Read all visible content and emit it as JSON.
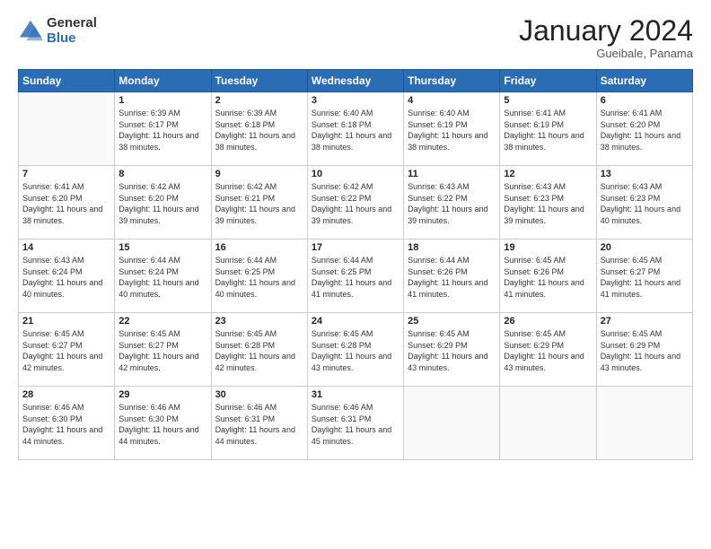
{
  "logo": {
    "general": "General",
    "blue": "Blue"
  },
  "header": {
    "month": "January 2024",
    "location": "Gueibale, Panama"
  },
  "weekdays": [
    "Sunday",
    "Monday",
    "Tuesday",
    "Wednesday",
    "Thursday",
    "Friday",
    "Saturday"
  ],
  "weeks": [
    [
      {
        "day": "",
        "sunrise": "",
        "sunset": "",
        "daylight": ""
      },
      {
        "day": "1",
        "sunrise": "Sunrise: 6:39 AM",
        "sunset": "Sunset: 6:17 PM",
        "daylight": "Daylight: 11 hours and 38 minutes."
      },
      {
        "day": "2",
        "sunrise": "Sunrise: 6:39 AM",
        "sunset": "Sunset: 6:18 PM",
        "daylight": "Daylight: 11 hours and 38 minutes."
      },
      {
        "day": "3",
        "sunrise": "Sunrise: 6:40 AM",
        "sunset": "Sunset: 6:18 PM",
        "daylight": "Daylight: 11 hours and 38 minutes."
      },
      {
        "day": "4",
        "sunrise": "Sunrise: 6:40 AM",
        "sunset": "Sunset: 6:19 PM",
        "daylight": "Daylight: 11 hours and 38 minutes."
      },
      {
        "day": "5",
        "sunrise": "Sunrise: 6:41 AM",
        "sunset": "Sunset: 6:19 PM",
        "daylight": "Daylight: 11 hours and 38 minutes."
      },
      {
        "day": "6",
        "sunrise": "Sunrise: 6:41 AM",
        "sunset": "Sunset: 6:20 PM",
        "daylight": "Daylight: 11 hours and 38 minutes."
      }
    ],
    [
      {
        "day": "7",
        "sunrise": "Sunrise: 6:41 AM",
        "sunset": "Sunset: 6:20 PM",
        "daylight": "Daylight: 11 hours and 38 minutes."
      },
      {
        "day": "8",
        "sunrise": "Sunrise: 6:42 AM",
        "sunset": "Sunset: 6:20 PM",
        "daylight": "Daylight: 11 hours and 39 minutes."
      },
      {
        "day": "9",
        "sunrise": "Sunrise: 6:42 AM",
        "sunset": "Sunset: 6:21 PM",
        "daylight": "Daylight: 11 hours and 39 minutes."
      },
      {
        "day": "10",
        "sunrise": "Sunrise: 6:42 AM",
        "sunset": "Sunset: 6:22 PM",
        "daylight": "Daylight: 11 hours and 39 minutes."
      },
      {
        "day": "11",
        "sunrise": "Sunrise: 6:43 AM",
        "sunset": "Sunset: 6:22 PM",
        "daylight": "Daylight: 11 hours and 39 minutes."
      },
      {
        "day": "12",
        "sunrise": "Sunrise: 6:43 AM",
        "sunset": "Sunset: 6:23 PM",
        "daylight": "Daylight: 11 hours and 39 minutes."
      },
      {
        "day": "13",
        "sunrise": "Sunrise: 6:43 AM",
        "sunset": "Sunset: 6:23 PM",
        "daylight": "Daylight: 11 hours and 40 minutes."
      }
    ],
    [
      {
        "day": "14",
        "sunrise": "Sunrise: 6:43 AM",
        "sunset": "Sunset: 6:24 PM",
        "daylight": "Daylight: 11 hours and 40 minutes."
      },
      {
        "day": "15",
        "sunrise": "Sunrise: 6:44 AM",
        "sunset": "Sunset: 6:24 PM",
        "daylight": "Daylight: 11 hours and 40 minutes."
      },
      {
        "day": "16",
        "sunrise": "Sunrise: 6:44 AM",
        "sunset": "Sunset: 6:25 PM",
        "daylight": "Daylight: 11 hours and 40 minutes."
      },
      {
        "day": "17",
        "sunrise": "Sunrise: 6:44 AM",
        "sunset": "Sunset: 6:25 PM",
        "daylight": "Daylight: 11 hours and 41 minutes."
      },
      {
        "day": "18",
        "sunrise": "Sunrise: 6:44 AM",
        "sunset": "Sunset: 6:26 PM",
        "daylight": "Daylight: 11 hours and 41 minutes."
      },
      {
        "day": "19",
        "sunrise": "Sunrise: 6:45 AM",
        "sunset": "Sunset: 6:26 PM",
        "daylight": "Daylight: 11 hours and 41 minutes."
      },
      {
        "day": "20",
        "sunrise": "Sunrise: 6:45 AM",
        "sunset": "Sunset: 6:27 PM",
        "daylight": "Daylight: 11 hours and 41 minutes."
      }
    ],
    [
      {
        "day": "21",
        "sunrise": "Sunrise: 6:45 AM",
        "sunset": "Sunset: 6:27 PM",
        "daylight": "Daylight: 11 hours and 42 minutes."
      },
      {
        "day": "22",
        "sunrise": "Sunrise: 6:45 AM",
        "sunset": "Sunset: 6:27 PM",
        "daylight": "Daylight: 11 hours and 42 minutes."
      },
      {
        "day": "23",
        "sunrise": "Sunrise: 6:45 AM",
        "sunset": "Sunset: 6:28 PM",
        "daylight": "Daylight: 11 hours and 42 minutes."
      },
      {
        "day": "24",
        "sunrise": "Sunrise: 6:45 AM",
        "sunset": "Sunset: 6:28 PM",
        "daylight": "Daylight: 11 hours and 43 minutes."
      },
      {
        "day": "25",
        "sunrise": "Sunrise: 6:45 AM",
        "sunset": "Sunset: 6:29 PM",
        "daylight": "Daylight: 11 hours and 43 minutes."
      },
      {
        "day": "26",
        "sunrise": "Sunrise: 6:45 AM",
        "sunset": "Sunset: 6:29 PM",
        "daylight": "Daylight: 11 hours and 43 minutes."
      },
      {
        "day": "27",
        "sunrise": "Sunrise: 6:45 AM",
        "sunset": "Sunset: 6:29 PM",
        "daylight": "Daylight: 11 hours and 43 minutes."
      }
    ],
    [
      {
        "day": "28",
        "sunrise": "Sunrise: 6:46 AM",
        "sunset": "Sunset: 6:30 PM",
        "daylight": "Daylight: 11 hours and 44 minutes."
      },
      {
        "day": "29",
        "sunrise": "Sunrise: 6:46 AM",
        "sunset": "Sunset: 6:30 PM",
        "daylight": "Daylight: 11 hours and 44 minutes."
      },
      {
        "day": "30",
        "sunrise": "Sunrise: 6:46 AM",
        "sunset": "Sunset: 6:31 PM",
        "daylight": "Daylight: 11 hours and 44 minutes."
      },
      {
        "day": "31",
        "sunrise": "Sunrise: 6:46 AM",
        "sunset": "Sunset: 6:31 PM",
        "daylight": "Daylight: 11 hours and 45 minutes."
      },
      {
        "day": "",
        "sunrise": "",
        "sunset": "",
        "daylight": ""
      },
      {
        "day": "",
        "sunrise": "",
        "sunset": "",
        "daylight": ""
      },
      {
        "day": "",
        "sunrise": "",
        "sunset": "",
        "daylight": ""
      }
    ]
  ]
}
